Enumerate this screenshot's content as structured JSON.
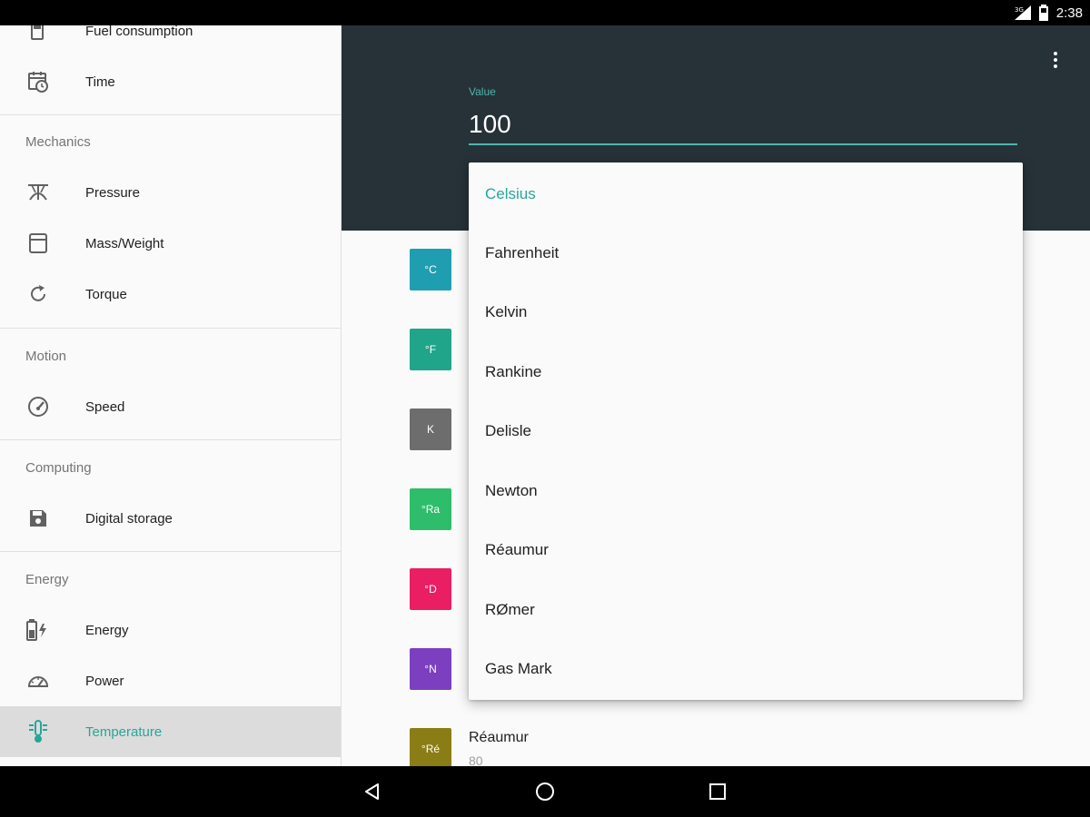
{
  "status_bar": {
    "time": "2:38"
  },
  "drawer": {
    "items_top": [
      {
        "label": "Fuel consumption",
        "icon": "fuel-icon"
      },
      {
        "label": "Time",
        "icon": "time-icon"
      }
    ],
    "sections": [
      {
        "header": "Mechanics",
        "items": [
          {
            "label": "Pressure",
            "icon": "pressure-icon"
          },
          {
            "label": "Mass/Weight",
            "icon": "weight-icon"
          },
          {
            "label": "Torque",
            "icon": "torque-icon"
          }
        ]
      },
      {
        "header": "Motion",
        "items": [
          {
            "label": "Speed",
            "icon": "speedometer-icon"
          }
        ]
      },
      {
        "header": "Computing",
        "items": [
          {
            "label": "Digital storage",
            "icon": "floppy-disk-icon"
          }
        ]
      },
      {
        "header": "Energy",
        "items": [
          {
            "label": "Energy",
            "icon": "battery-charging-icon"
          },
          {
            "label": "Power",
            "icon": "power-gauge-icon"
          },
          {
            "label": "Temperature",
            "icon": "thermometer-icon",
            "active": true
          }
        ]
      }
    ]
  },
  "header": {
    "value_label": "Value",
    "value": "100"
  },
  "results": [
    {
      "badge": "°C",
      "color": "#1e9eb0"
    },
    {
      "badge": "°F",
      "color": "#20a58a"
    },
    {
      "badge": "K",
      "color": "#6d6d6d"
    },
    {
      "badge": "°Ra",
      "color": "#2ebd6b"
    },
    {
      "badge": "°D",
      "color": "#e91e63"
    },
    {
      "badge": "°N",
      "color": "#7b3fbf"
    },
    {
      "badge": "°Ré",
      "color": "#8a7d15",
      "name": "Réaumur",
      "value": "80"
    }
  ],
  "dropdown": {
    "selected": "Celsius",
    "options": [
      "Celsius",
      "Fahrenheit",
      "Kelvin",
      "Rankine",
      "Delisle",
      "Newton",
      "Réaumur",
      "RØmer",
      "Gas Mark"
    ]
  },
  "colors": {
    "accent": "#26a69a",
    "header_bg": "#263238"
  }
}
